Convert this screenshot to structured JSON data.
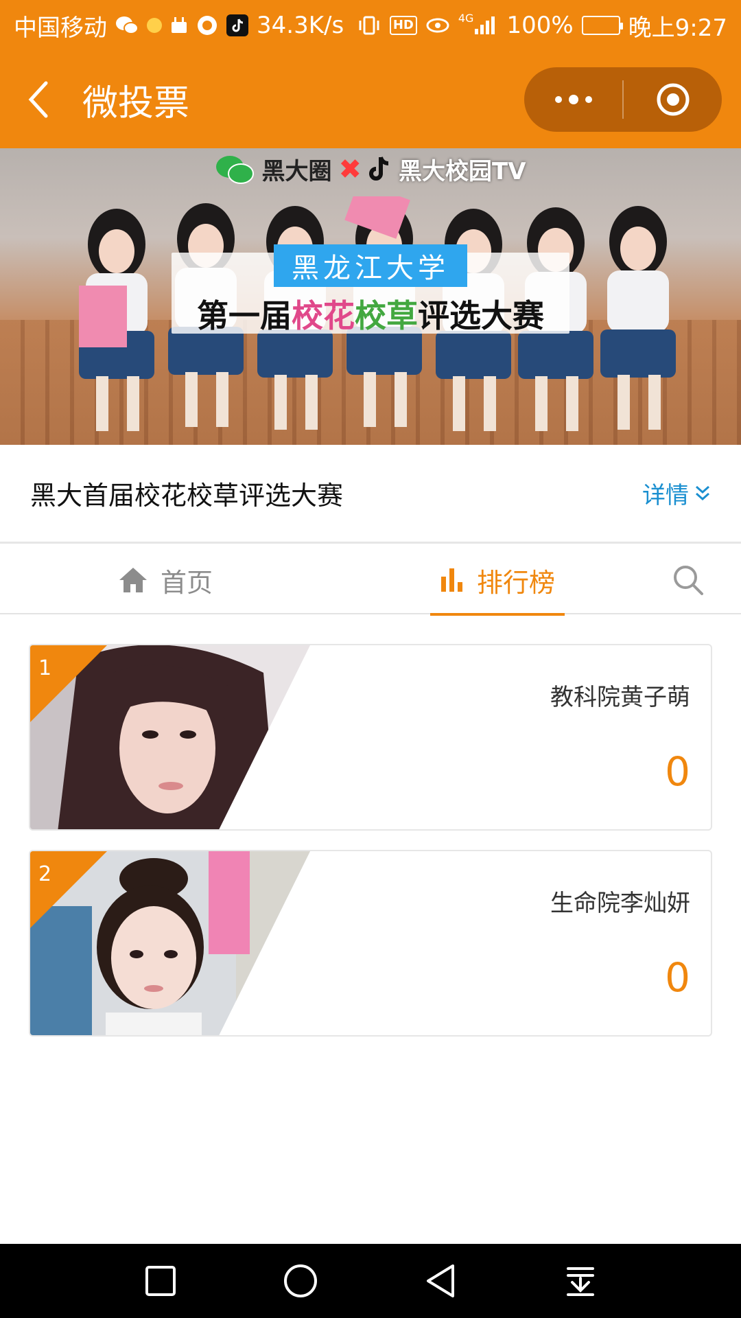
{
  "status_bar": {
    "carrier": "中国移动",
    "speed": "34.3K/s",
    "hd": "HD",
    "network": "4G",
    "battery": "100%",
    "time": "晚上9:27"
  },
  "nav": {
    "title": "微投票"
  },
  "banner": {
    "sponsor_left": "黑大圈",
    "sponsor_right": "黑大校园TV",
    "university": "黑龙江大学",
    "contest_prefix": "第一届",
    "contest_pink": "校花",
    "contest_green": "校草",
    "contest_suffix": "评选大赛"
  },
  "info": {
    "title": "黑大首届校花校草评选大赛",
    "details_label": "详情"
  },
  "tabs": [
    {
      "label": "首页",
      "active": false
    },
    {
      "label": "排行榜",
      "active": true
    }
  ],
  "rankings": [
    {
      "rank": "1",
      "name": "教科院黄子萌",
      "votes": "0"
    },
    {
      "rank": "2",
      "name": "生命院李灿妍",
      "votes": "0"
    }
  ],
  "colors": {
    "accent": "#f0870e",
    "link": "#1a8fd0"
  }
}
